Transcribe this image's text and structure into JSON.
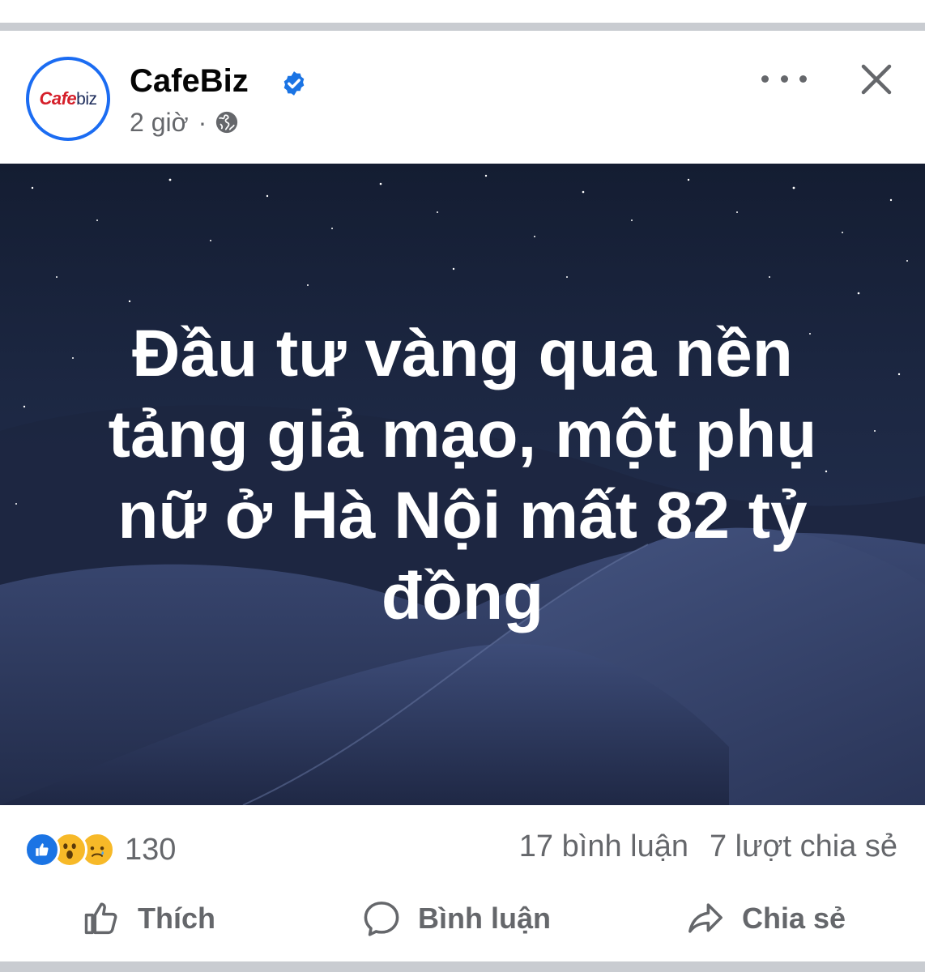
{
  "post": {
    "page_name": "CafeBiz",
    "logo_text_a": "Cafe",
    "logo_text_b": "biz",
    "time": "2 giờ",
    "separator": "·",
    "image_text_lines": [
      "Đầu tư vàng qua nền",
      "tảng giả mạo, một phụ",
      "nữ ở Hà Nội mất 82 tỷ",
      "đồng"
    ]
  },
  "icons": {
    "verified": "verified-badge-icon",
    "audience": "globe-icon",
    "more": "more-options-icon",
    "close": "close-icon"
  },
  "stats": {
    "reaction_count": "130",
    "comments": "17 bình luận",
    "shares": "7 lượt chia sẻ"
  },
  "actions": {
    "like": "Thích",
    "comment": "Bình luận",
    "share": "Chia sẻ"
  },
  "colors": {
    "brand_blue": "#1b74e4",
    "secondary_text": "#65676b",
    "logo_red": "#d51f2a"
  }
}
